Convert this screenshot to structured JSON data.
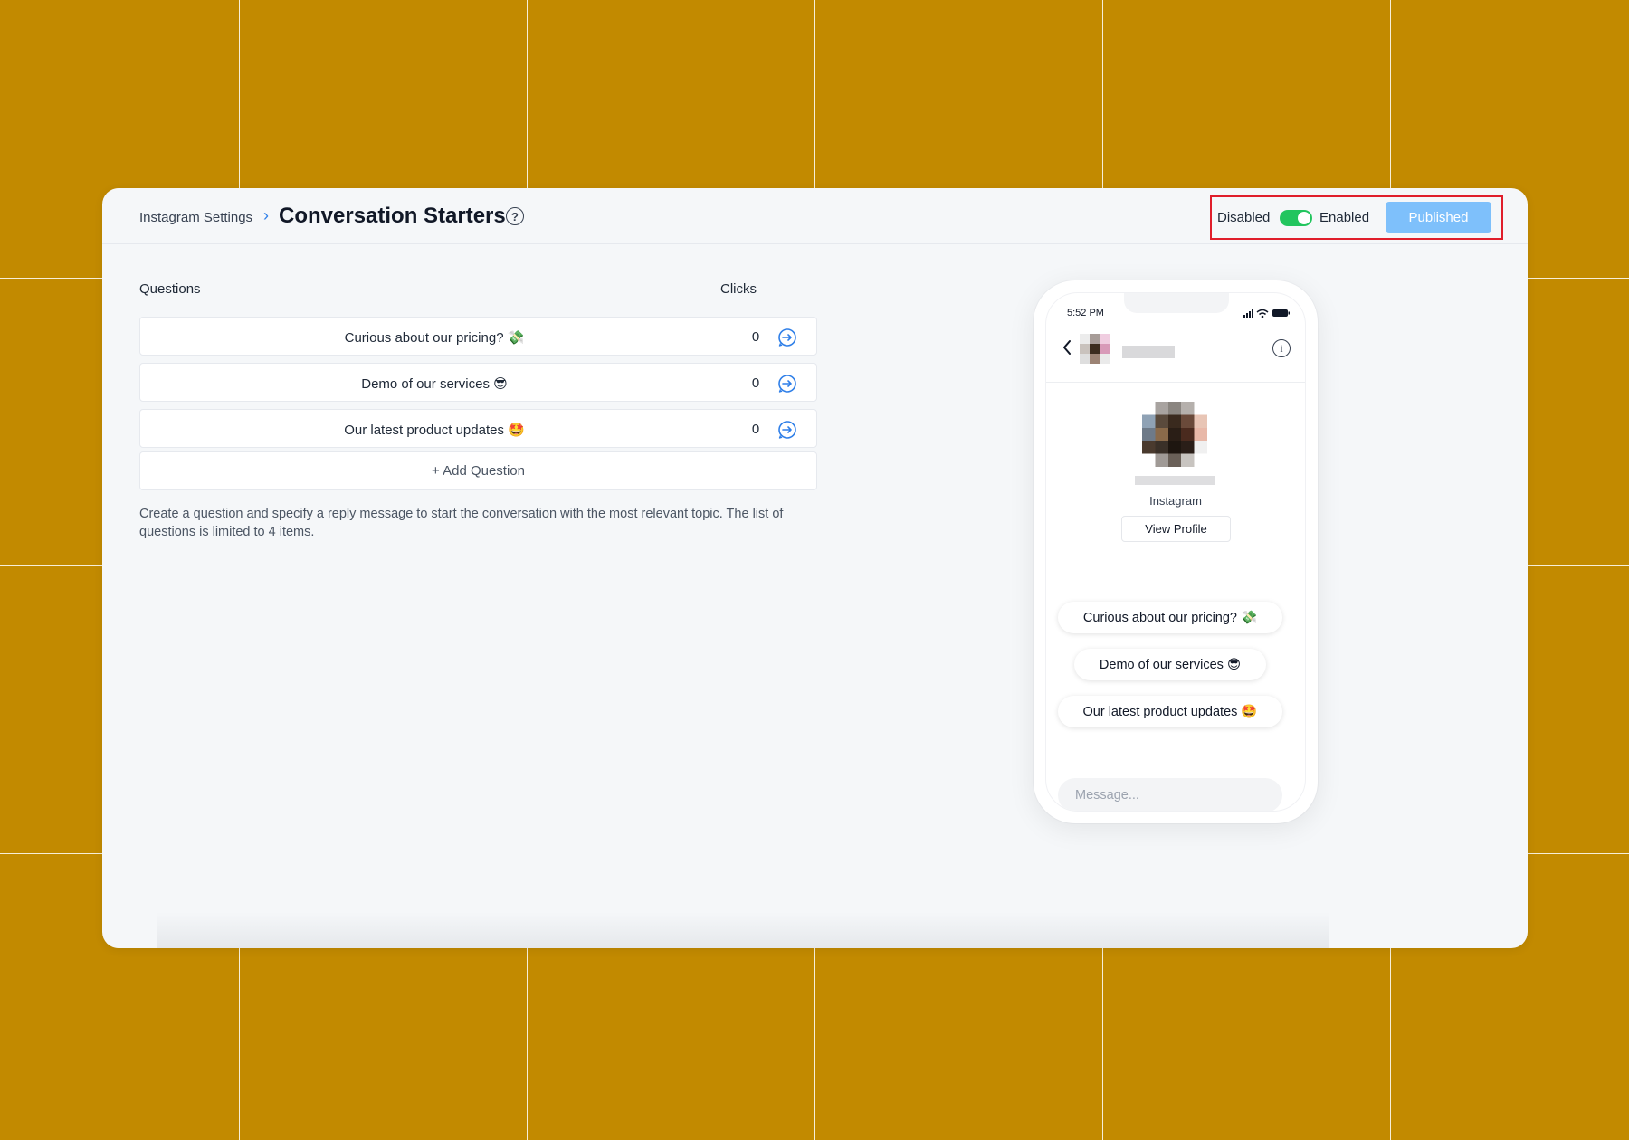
{
  "header": {
    "breadcrumb": "Instagram Settings",
    "separator": "›",
    "title": "Conversation Starters",
    "help_glyph": "?",
    "toggle_off_label": "Disabled",
    "toggle_on_label": "Enabled",
    "toggle_state": "enabled",
    "publish_label": "Published"
  },
  "table": {
    "col_questions": "Questions",
    "col_clicks": "Clicks",
    "rows": [
      {
        "question": "Curious about our pricing? 💸",
        "clicks": "0"
      },
      {
        "question": "Demo of our services 😎",
        "clicks": "0"
      },
      {
        "question": "Our latest product updates 🤩",
        "clicks": "0"
      }
    ],
    "add_label": "+ Add Question",
    "help_text": "Create a question and specify a reply message to start the conversation with the most relevant topic. The list of questions is limited to 4 items."
  },
  "preview": {
    "status_time": "5:52 PM",
    "info_glyph": "i",
    "platform": "Instagram",
    "view_profile": "View Profile",
    "chips": [
      "Curious about our pricing? 💸",
      "Demo of our services 😎",
      "Our latest product updates 🤩"
    ],
    "message_placeholder": "Message..."
  },
  "colors": {
    "background": "#C28A00",
    "accent": "#2F7FE8",
    "toggle_on": "#22C55E",
    "publish_button": "#7EC0FB",
    "highlight": "#E01E2B"
  }
}
